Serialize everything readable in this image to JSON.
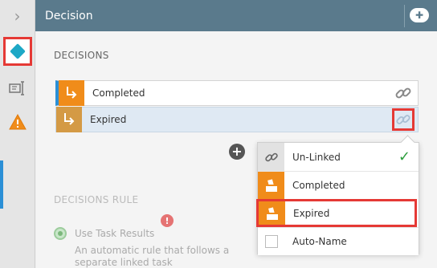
{
  "rail": {
    "collapse_icon": "chevron-right-icon",
    "items": [
      "decision-diamond-icon",
      "text-field-icon",
      "warning-icon"
    ]
  },
  "header": {
    "title": "Decision",
    "action_icon": "add-pill-icon"
  },
  "decisions": {
    "section_title": "DECISIONS",
    "rows": [
      {
        "label": "Completed",
        "state": "linked"
      },
      {
        "label": "Expired",
        "state": "selected"
      }
    ]
  },
  "link_menu": {
    "options": [
      {
        "label": "Un-Linked",
        "icon": "link-icon",
        "checked": true
      },
      {
        "label": "Completed",
        "icon": "ballot-box-icon"
      },
      {
        "label": "Expired",
        "icon": "ballot-box-icon"
      },
      {
        "label": "Auto-Name",
        "icon": "checkbox-icon"
      }
    ]
  },
  "decisions_rule": {
    "section_title": "DECISIONS RULE",
    "option_label": "Use Task Results",
    "description": "An automatic rule that follows a separate linked task"
  },
  "colors": {
    "header_bg": "#5a7a8c",
    "accent_blue": "#2b8fd6",
    "tile_orange": "#f08c1a",
    "highlight_red": "#e53935",
    "check_green": "#2e9e3e"
  }
}
